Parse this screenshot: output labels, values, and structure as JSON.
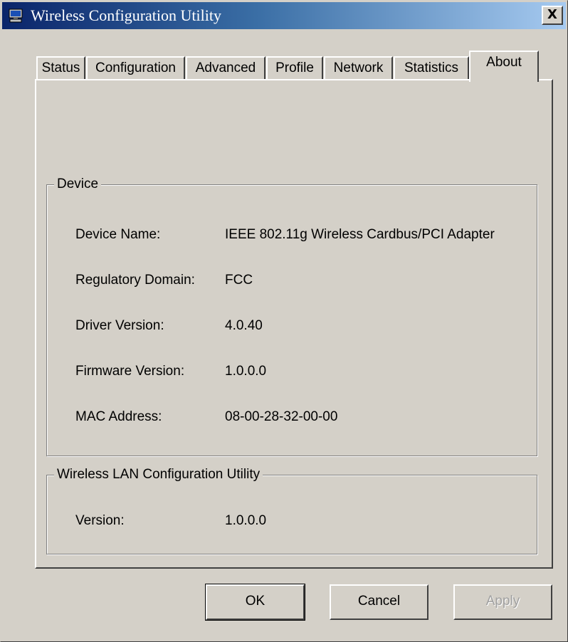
{
  "window": {
    "title": "Wireless Configuration Utility",
    "close_label": "X"
  },
  "tabs": [
    {
      "label": "Status"
    },
    {
      "label": "Configuration"
    },
    {
      "label": "Advanced"
    },
    {
      "label": "Profile"
    },
    {
      "label": "Network"
    },
    {
      "label": "Statistics"
    },
    {
      "label": "About",
      "active": true
    }
  ],
  "device": {
    "title": "Device",
    "rows": [
      {
        "label": "Device Name:",
        "value": "IEEE 802.11g Wireless Cardbus/PCI Adapter"
      },
      {
        "label": "Regulatory Domain:",
        "value": "FCC"
      },
      {
        "label": "Driver Version:",
        "value": "4.0.40"
      },
      {
        "label": "Firmware Version:",
        "value": "1.0.0.0"
      },
      {
        "label": "MAC Address:",
        "value": "08-00-28-32-00-00"
      }
    ]
  },
  "utility": {
    "title": "Wireless LAN Configuration Utility",
    "rows": [
      {
        "label": "Version:",
        "value": "1.0.0.0"
      }
    ]
  },
  "buttons": {
    "ok": "OK",
    "cancel": "Cancel",
    "apply": "Apply"
  },
  "colors": {
    "face": "#d4d0c8",
    "title_start": "#0a246a",
    "title_end": "#a6caf0"
  },
  "icons": {
    "app": "computer-monitor-icon"
  }
}
